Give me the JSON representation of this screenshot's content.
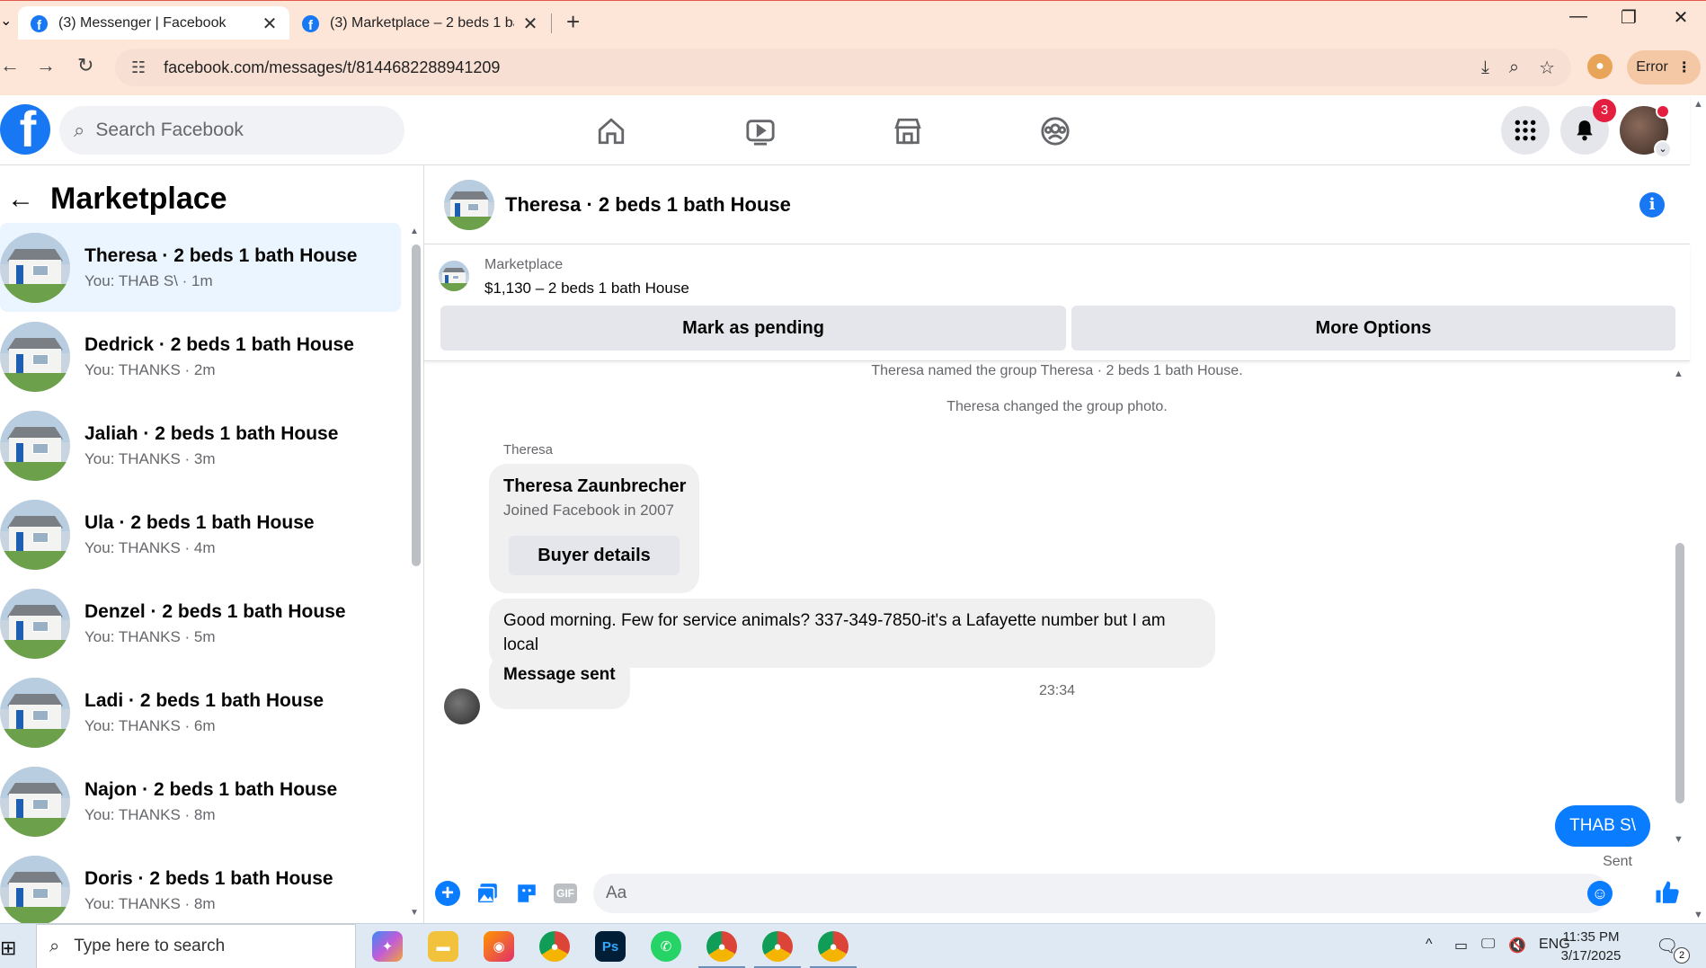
{
  "browser": {
    "tabs": [
      {
        "title": "(3) Messenger | Facebook",
        "active": true
      },
      {
        "title": "(3) Marketplace – 2 beds 1 bath",
        "active": false
      }
    ],
    "url": "facebook.com/messages/t/8144682288941209",
    "profile_status": "Error"
  },
  "fb_header": {
    "search_placeholder": "Search Facebook",
    "notification_count": "3",
    "nav_icons": [
      "home-icon",
      "video-icon",
      "marketplace-icon",
      "groups-icon"
    ]
  },
  "left_panel": {
    "title": "Marketplace",
    "conversations": [
      {
        "name": "Theresa · 2 beds 1 bath House",
        "preview": "You: THAB S\\ · 1m",
        "active": true
      },
      {
        "name": "Dedrick · 2 beds 1 bath House",
        "preview": "You: THANKS · 2m",
        "active": false
      },
      {
        "name": "Jaliah · 2 beds 1 bath House",
        "preview": "You: THANKS · 3m",
        "active": false
      },
      {
        "name": "Ula · 2 beds 1 bath House",
        "preview": "You: THANKS · 4m",
        "active": false
      },
      {
        "name": "Denzel · 2 beds 1 bath House",
        "preview": "You: THANKS · 5m",
        "active": false
      },
      {
        "name": "Ladi · 2 beds 1 bath House",
        "preview": "You: THANKS · 6m",
        "active": false
      },
      {
        "name": "Najon · 2 beds 1 bath House",
        "preview": "You: THANKS · 8m",
        "active": false
      },
      {
        "name": "Doris · 2 beds 1 bath House",
        "preview": "You: THANKS · 8m",
        "active": false
      }
    ]
  },
  "chat": {
    "title": "Theresa · 2 beds 1 bath House",
    "listing": {
      "label": "Marketplace",
      "price_line": "$1,130 – 2 beds 1 bath House",
      "mark_pending": "Mark as pending",
      "more_options": "More Options"
    },
    "system_messages": [
      "Theresa named the group Theresa · 2 beds 1 bath House.",
      "Theresa changed the group photo."
    ],
    "sender_name": "Theresa",
    "profile_card": {
      "name": "Theresa Zaunbrecher",
      "subtitle": "Joined Facebook in 2007",
      "button": "Buyer details"
    },
    "incoming_message": "Good morning. Few for service animals? 337-349-7850-it's a Lafayette number but I am local",
    "message_sent": "Message sent",
    "timestamp": "23:34",
    "outgoing_message": "THAB S\\",
    "outgoing_status": "Sent",
    "composer_placeholder": "Aa",
    "gif_label": "GIF"
  },
  "taskbar": {
    "search_placeholder": "Type here to search",
    "language": "ENG",
    "time": "11:35 PM",
    "date": "3/17/2025",
    "notification_count": "2"
  }
}
